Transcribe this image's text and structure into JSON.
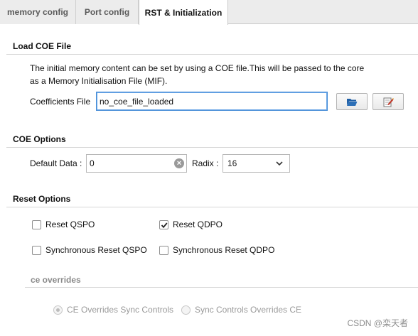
{
  "tabs": [
    {
      "label": "memory config"
    },
    {
      "label": "Port config"
    },
    {
      "label": "RST & Initialization"
    }
  ],
  "load_coe": {
    "title": "Load COE File",
    "description_line1": "The initial memory content can be set by using a COE file.This will be passed to the core",
    "description_line2": "as a Memory Initialisation File (MIF).",
    "coeff_label": "Coefficients File",
    "coeff_value": "no_coe_file_loaded",
    "browse_icon": "folder-open-icon",
    "edit_icon": "edit-document-icon"
  },
  "coe_options": {
    "title": "COE Options",
    "default_data_label": "Default Data :",
    "default_data_value": "0",
    "radix_label": "Radix :",
    "radix_value": "16"
  },
  "reset_options": {
    "title": "Reset Options",
    "reset_qspo": {
      "label": "Reset QSPO",
      "checked": false
    },
    "reset_qdpo": {
      "label": "Reset QDPO",
      "checked": true
    },
    "sync_reset_qspo": {
      "label": "Synchronous Reset QSPO",
      "checked": false
    },
    "sync_reset_qdpo": {
      "label": "Synchronous Reset QDPO",
      "checked": false
    },
    "ce_overrides_title": "ce overrides",
    "ce_overrides_sync": {
      "label": "CE Overrides Sync Controls",
      "selected": true
    },
    "sync_overrides_ce": {
      "label": "Sync Controls Overrides CE",
      "selected": false
    }
  },
  "watermark": "CSDN @栾天者",
  "colors": {
    "focus": "#4a8fd8",
    "folder": "#2c6fb7"
  }
}
